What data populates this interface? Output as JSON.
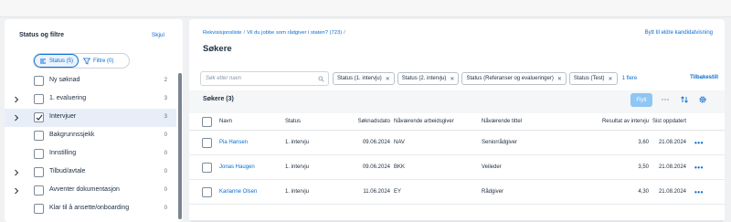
{
  "filters_panel": {
    "title": "Status og filtre",
    "hide_label": "Skjul",
    "tabs": [
      {
        "label": "Status (5)",
        "active": true,
        "icon": "status-icon"
      },
      {
        "label": "Filtre (0)",
        "active": false,
        "icon": "filter-icon"
      }
    ],
    "items": [
      {
        "label": "Ny søknad",
        "count": "2",
        "checked": false,
        "expandable": false
      },
      {
        "label": "1. evaluering",
        "count": "3",
        "checked": false,
        "expandable": true
      },
      {
        "label": "Intervjuer",
        "count": "3",
        "checked": true,
        "expandable": true
      },
      {
        "label": "Bakgrunnssjekk",
        "count": "0",
        "checked": false,
        "expandable": false
      },
      {
        "label": "Innstilling",
        "count": "0",
        "checked": false,
        "expandable": false
      },
      {
        "label": "Tilbud/avtale",
        "count": "0",
        "checked": false,
        "expandable": true
      },
      {
        "label": "Avventer dokumentasjon",
        "count": "0",
        "checked": false,
        "expandable": true
      },
      {
        "label": "Klar til å ansette/onboarding",
        "count": "0",
        "checked": false,
        "expandable": false
      }
    ]
  },
  "header": {
    "breadcrumbs": [
      "Rekvisisjonsliste",
      "Vil du jobbe som rådgiver i staten? (723)"
    ],
    "title": "Søkere",
    "old_candidates_link": "Bytt til eldre kandidatvisning"
  },
  "search": {
    "placeholder": "Søk etter navn"
  },
  "filter_tokens": [
    "Status (1. intervju)",
    "Status (2. intervju)",
    "Status (Referanser og evalueringer)",
    "Status (Test)"
  ],
  "more_tokens_label": "1 flere",
  "reset_label": "Tilbakestill",
  "table": {
    "title": "Søkere (3)",
    "move_label": "Flytt",
    "columns": [
      "Navn",
      "Status",
      "Søknadsdato",
      "Nåværende arbeidsgiver",
      "Nåværende tittel",
      "Resultat av intervju",
      "Sist oppdatert"
    ],
    "rows": [
      {
        "name": "Pia Hansen",
        "status": "1. intervju",
        "date": "09.06.2024",
        "employer": "NAV",
        "title": "Seniorrådgiver",
        "score": "3,60",
        "updated": "21.08.2024"
      },
      {
        "name": "Jonas Haugen",
        "status": "1. intervju",
        "date": "09.06.2024",
        "employer": "BKK",
        "title": "Veileder",
        "score": "3,50",
        "updated": "21.08.2024"
      },
      {
        "name": "Karianne Olsen",
        "status": "1. intervju",
        "date": "11.06.2024",
        "employer": "EY",
        "title": "Rådgiver",
        "score": "4,30",
        "updated": "21.08.2024"
      }
    ]
  },
  "colors": {
    "accent": "#0a6ed1",
    "text": "#1d2d3e",
    "background": "#f0f1f3"
  }
}
